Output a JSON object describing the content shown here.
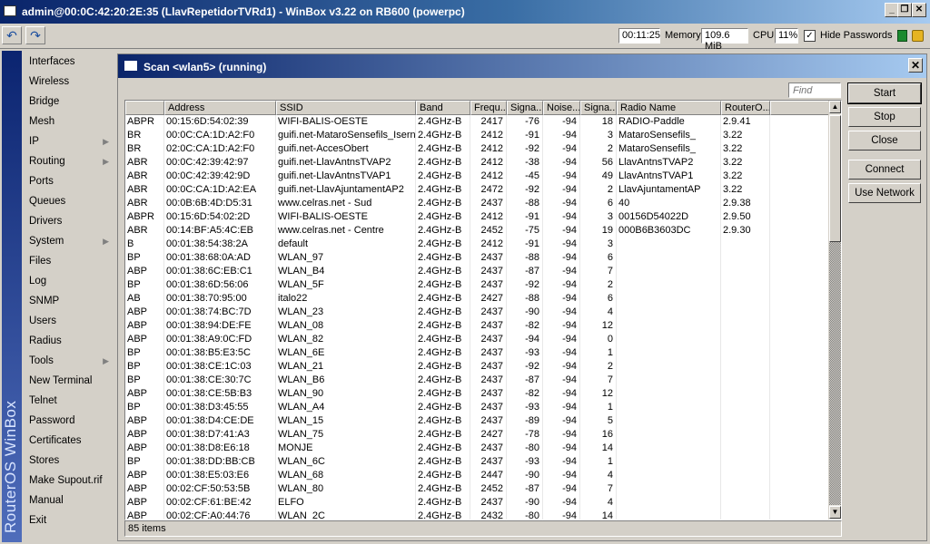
{
  "window": {
    "title": "admin@00:0C:42:20:2E:35 (LlavRepetidorTVRd1) - WinBox v3.22 on RB600 (powerpc)",
    "controls": [
      "_",
      "❐",
      "✕"
    ]
  },
  "toolbar": {
    "undo_icon": "↶",
    "redo_icon": "↷",
    "uptime": "00:11:25",
    "memory_label": "Memory:",
    "memory_value": "109.6 MiB",
    "cpu_label": "CPU:",
    "cpu_value": "11%",
    "hide_passwords_label": "Hide Passwords",
    "hide_passwords_checked": "✓"
  },
  "sidebar": {
    "brand": "RouterOS WinBox",
    "items": [
      {
        "label": "Interfaces",
        "sub": ""
      },
      {
        "label": "Wireless",
        "sub": ""
      },
      {
        "label": "Bridge",
        "sub": ""
      },
      {
        "label": "Mesh",
        "sub": ""
      },
      {
        "label": "IP",
        "sub": "▶"
      },
      {
        "label": "Routing",
        "sub": "▶"
      },
      {
        "label": "Ports",
        "sub": ""
      },
      {
        "label": "Queues",
        "sub": ""
      },
      {
        "label": "Drivers",
        "sub": ""
      },
      {
        "label": "System",
        "sub": "▶"
      },
      {
        "label": "Files",
        "sub": ""
      },
      {
        "label": "Log",
        "sub": ""
      },
      {
        "label": "SNMP",
        "sub": ""
      },
      {
        "label": "Users",
        "sub": ""
      },
      {
        "label": "Radius",
        "sub": ""
      },
      {
        "label": "Tools",
        "sub": "▶"
      },
      {
        "label": "New Terminal",
        "sub": ""
      },
      {
        "label": "Telnet",
        "sub": ""
      },
      {
        "label": "Password",
        "sub": ""
      },
      {
        "label": "Certificates",
        "sub": ""
      },
      {
        "label": "Stores",
        "sub": ""
      },
      {
        "label": "Make Supout.rif",
        "sub": ""
      },
      {
        "label": "Manual",
        "sub": ""
      },
      {
        "label": "Exit",
        "sub": ""
      }
    ]
  },
  "scan": {
    "title": "Scan <wlan5> (running)",
    "close": "✕",
    "find_placeholder": "Find",
    "buttons": {
      "start": "Start",
      "stop": "Stop",
      "close": "Close",
      "connect": "Connect",
      "use_network": "Use Network"
    },
    "columns": [
      "",
      "Address",
      "SSID",
      "Band",
      "Frequ...",
      "Signa...",
      "Noise...",
      "Signa...",
      "Radio Name",
      "RouterO..."
    ],
    "rows": [
      [
        "ABPR",
        "00:15:6D:54:02:39",
        "WIFI-BALIS-OESTE",
        "2.4GHz-B",
        "2417",
        "-76",
        "-94",
        "18",
        "RADIO-Paddle",
        "2.9.41"
      ],
      [
        "BR",
        "00:0C:CA:1D:A2:F0",
        "guifi.net-MataroSensefils_Isern",
        "2.4GHz-B",
        "2412",
        "-91",
        "-94",
        "3",
        "MataroSensefils_",
        "3.22"
      ],
      [
        "BR",
        "02:0C:CA:1D:A2:F0",
        "guifi.net-AccesObert",
        "2.4GHz-B",
        "2412",
        "-92",
        "-94",
        "2",
        "MataroSensefils_",
        "3.22"
      ],
      [
        "ABR",
        "00:0C:42:39:42:97",
        "guifi.net-LlavAntnsTVAP2",
        "2.4GHz-B",
        "2412",
        "-38",
        "-94",
        "56",
        "LlavAntnsTVAP2",
        "3.22"
      ],
      [
        "ABR",
        "00:0C:42:39:42:9D",
        "guifi.net-LlavAntnsTVAP1",
        "2.4GHz-B",
        "2412",
        "-45",
        "-94",
        "49",
        "LlavAntnsTVAP1",
        "3.22"
      ],
      [
        "ABR",
        "00:0C:CA:1D:A2:EA",
        "guifi.net-LlavAjuntamentAP2",
        "2.4GHz-B",
        "2472",
        "-92",
        "-94",
        "2",
        "LlavAjuntamentAP",
        "3.22"
      ],
      [
        "ABR",
        "00:0B:6B:4D:D5:31",
        "www.celras.net - Sud",
        "2.4GHz-B",
        "2437",
        "-88",
        "-94",
        "6",
        "40",
        "2.9.38"
      ],
      [
        "ABPR",
        "00:15:6D:54:02:2D",
        "WIFI-BALIS-OESTE",
        "2.4GHz-B",
        "2412",
        "-91",
        "-94",
        "3",
        "00156D54022D",
        "2.9.50"
      ],
      [
        "ABR",
        "00:14:BF:A5:4C:EB",
        "www.celras.net - Centre",
        "2.4GHz-B",
        "2452",
        "-75",
        "-94",
        "19",
        "000B6B3603DC",
        "2.9.30"
      ],
      [
        "B",
        "00:01:38:54:38:2A",
        "default",
        "2.4GHz-B",
        "2412",
        "-91",
        "-94",
        "3",
        "",
        ""
      ],
      [
        "BP",
        "00:01:38:68:0A:AD",
        "WLAN_97",
        "2.4GHz-B",
        "2437",
        "-88",
        "-94",
        "6",
        "",
        ""
      ],
      [
        "ABP",
        "00:01:38:6C:EB:C1",
        "WLAN_B4",
        "2.4GHz-B",
        "2437",
        "-87",
        "-94",
        "7",
        "",
        ""
      ],
      [
        "BP",
        "00:01:38:6D:56:06",
        "WLAN_5F",
        "2.4GHz-B",
        "2437",
        "-92",
        "-94",
        "2",
        "",
        ""
      ],
      [
        "AB",
        "00:01:38:70:95:00",
        "italo22",
        "2.4GHz-B",
        "2427",
        "-88",
        "-94",
        "6",
        "",
        ""
      ],
      [
        "ABP",
        "00:01:38:74:BC:7D",
        "WLAN_23",
        "2.4GHz-B",
        "2437",
        "-90",
        "-94",
        "4",
        "",
        ""
      ],
      [
        "ABP",
        "00:01:38:94:DE:FE",
        "WLAN_08",
        "2.4GHz-B",
        "2437",
        "-82",
        "-94",
        "12",
        "",
        ""
      ],
      [
        "ABP",
        "00:01:38:A9:0C:FD",
        "WLAN_82",
        "2.4GHz-B",
        "2437",
        "-94",
        "-94",
        "0",
        "",
        ""
      ],
      [
        "BP",
        "00:01:38:B5:E3:5C",
        "WLAN_6E",
        "2.4GHz-B",
        "2437",
        "-93",
        "-94",
        "1",
        "",
        ""
      ],
      [
        "BP",
        "00:01:38:CE:1C:03",
        "WLAN_21",
        "2.4GHz-B",
        "2437",
        "-92",
        "-94",
        "2",
        "",
        ""
      ],
      [
        "BP",
        "00:01:38:CE:30:7C",
        "WLAN_B6",
        "2.4GHz-B",
        "2437",
        "-87",
        "-94",
        "7",
        "",
        ""
      ],
      [
        "ABP",
        "00:01:38:CE:5B:B3",
        "WLAN_90",
        "2.4GHz-B",
        "2437",
        "-82",
        "-94",
        "12",
        "",
        ""
      ],
      [
        "BP",
        "00:01:38:D3:45:55",
        "WLAN_A4",
        "2.4GHz-B",
        "2437",
        "-93",
        "-94",
        "1",
        "",
        ""
      ],
      [
        "ABP",
        "00:01:38:D4:CE:DE",
        "WLAN_15",
        "2.4GHz-B",
        "2437",
        "-89",
        "-94",
        "5",
        "",
        ""
      ],
      [
        "ABP",
        "00:01:38:D7:41:A3",
        "WLAN_75",
        "2.4GHz-B",
        "2427",
        "-78",
        "-94",
        "16",
        "",
        ""
      ],
      [
        "ABP",
        "00:01:38:D8:E6:18",
        "MONJE",
        "2.4GHz-B",
        "2437",
        "-80",
        "-94",
        "14",
        "",
        ""
      ],
      [
        "BP",
        "00:01:38:DD:BB:CB",
        "WLAN_6C",
        "2.4GHz-B",
        "2437",
        "-93",
        "-94",
        "1",
        "",
        ""
      ],
      [
        "ABP",
        "00:01:38:E5:03:E6",
        "WLAN_68",
        "2.4GHz-B",
        "2447",
        "-90",
        "-94",
        "4",
        "",
        ""
      ],
      [
        "ABP",
        "00:02:CF:50:53:5B",
        "WLAN_80",
        "2.4GHz-B",
        "2452",
        "-87",
        "-94",
        "7",
        "",
        ""
      ],
      [
        "ABP",
        "00:02:CF:61:BE:42",
        "ELFO",
        "2.4GHz-B",
        "2437",
        "-90",
        "-94",
        "4",
        "",
        ""
      ],
      [
        "ABP",
        "00:02:CF:A0:44:76",
        "WLAN_2C",
        "2.4GHz-B",
        "2432",
        "-80",
        "-94",
        "14",
        "",
        ""
      ]
    ],
    "item_count": "85 items"
  }
}
